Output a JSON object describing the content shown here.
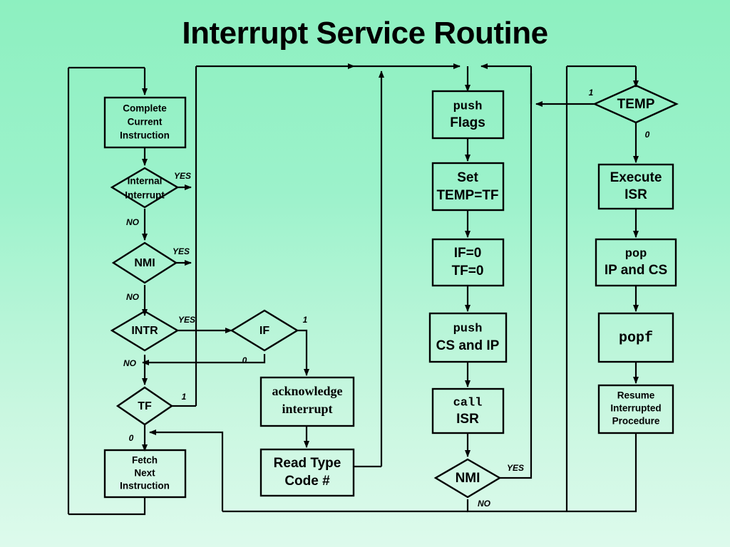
{
  "title": "Interrupt Service Routine",
  "colors": {
    "background_top": "#8df0c0",
    "background_bottom": "#ddfaec",
    "stroke": "#000000",
    "text": "#000000"
  },
  "nodes": {
    "complete_current_instruction": {
      "kind": "process",
      "lines": [
        "Complete",
        "Current",
        "Instruction"
      ]
    },
    "internal_interrupt": {
      "kind": "decision",
      "lines": [
        "Internal",
        "Interrupt"
      ]
    },
    "nmi_left": {
      "kind": "decision",
      "lines": [
        "NMI"
      ]
    },
    "intr": {
      "kind": "decision",
      "lines": [
        "INTR"
      ]
    },
    "if_flag": {
      "kind": "decision",
      "lines": [
        "IF"
      ]
    },
    "tf_flag": {
      "kind": "decision",
      "lines": [
        "TF"
      ]
    },
    "fetch_next_instruction": {
      "kind": "process",
      "lines": [
        "Fetch",
        "Next",
        "Instruction"
      ]
    },
    "acknowledge_interrupt": {
      "kind": "process",
      "lines": [
        "acknowledge",
        "interrupt"
      ]
    },
    "read_type_code": {
      "kind": "process",
      "lines": [
        "Read Type",
        "Code #"
      ]
    },
    "push_flags": {
      "kind": "process",
      "lines": [
        "push",
        "Flags"
      ]
    },
    "set_temp_tf": {
      "kind": "process",
      "lines": [
        "Set",
        "TEMP=TF"
      ]
    },
    "clear_if_tf": {
      "kind": "process",
      "lines": [
        "IF=0",
        "TF=0"
      ]
    },
    "push_cs_ip": {
      "kind": "process",
      "lines": [
        "push",
        "CS and IP"
      ]
    },
    "call_isr": {
      "kind": "process",
      "lines": [
        "call",
        "ISR"
      ]
    },
    "nmi_mid": {
      "kind": "decision",
      "lines": [
        "NMI"
      ]
    },
    "temp": {
      "kind": "decision",
      "lines": [
        "TEMP"
      ]
    },
    "execute_isr": {
      "kind": "process",
      "lines": [
        "Execute",
        "ISR"
      ]
    },
    "pop_ip_cs": {
      "kind": "process",
      "lines": [
        "pop",
        "IP and CS"
      ]
    },
    "popf": {
      "kind": "process",
      "lines": [
        "popf"
      ]
    },
    "resume_interrupted": {
      "kind": "process",
      "lines": [
        "Resume",
        "Interrupted",
        "Procedure"
      ]
    }
  },
  "edge_labels": {
    "internal_interrupt_yes": "YES",
    "internal_interrupt_no": "NO",
    "nmi_left_yes": "YES",
    "nmi_left_no": "NO",
    "intr_yes": "YES",
    "intr_no": "NO",
    "if_one": "1",
    "if_zero": "0",
    "tf_one": "1",
    "tf_zero": "0",
    "nmi_mid_yes": "YES",
    "nmi_mid_no": "NO",
    "temp_one": "1",
    "temp_zero": "0"
  },
  "chart_data": {
    "type": "flowchart",
    "title": "Interrupt Service Routine",
    "nodes": [
      {
        "id": "complete_current_instruction",
        "shape": "rect",
        "text": "Complete Current Instruction",
        "column": "left"
      },
      {
        "id": "internal_interrupt",
        "shape": "diamond",
        "text": "Internal Interrupt",
        "column": "left"
      },
      {
        "id": "nmi_left",
        "shape": "diamond",
        "text": "NMI",
        "column": "left"
      },
      {
        "id": "intr",
        "shape": "diamond",
        "text": "INTR",
        "column": "left"
      },
      {
        "id": "tf_flag",
        "shape": "diamond",
        "text": "TF",
        "column": "left"
      },
      {
        "id": "fetch_next_instruction",
        "shape": "rect",
        "text": "Fetch Next Instruction",
        "column": "left"
      },
      {
        "id": "if_flag",
        "shape": "diamond",
        "text": "IF",
        "column": "mid-left"
      },
      {
        "id": "acknowledge_interrupt",
        "shape": "rect",
        "text": "acknowledge interrupt",
        "column": "mid-left"
      },
      {
        "id": "read_type_code",
        "shape": "rect",
        "text": "Read Type Code #",
        "column": "mid-left"
      },
      {
        "id": "push_flags",
        "shape": "rect",
        "text": "push Flags",
        "column": "middle"
      },
      {
        "id": "set_temp_tf",
        "shape": "rect",
        "text": "Set TEMP=TF",
        "column": "middle"
      },
      {
        "id": "clear_if_tf",
        "shape": "rect",
        "text": "IF=0 TF=0",
        "column": "middle"
      },
      {
        "id": "push_cs_ip",
        "shape": "rect",
        "text": "push CS and IP",
        "column": "middle"
      },
      {
        "id": "call_isr",
        "shape": "rect",
        "text": "call ISR",
        "column": "middle"
      },
      {
        "id": "nmi_mid",
        "shape": "diamond",
        "text": "NMI",
        "column": "middle"
      },
      {
        "id": "temp",
        "shape": "diamond",
        "text": "TEMP",
        "column": "right"
      },
      {
        "id": "execute_isr",
        "shape": "rect",
        "text": "Execute ISR",
        "column": "right"
      },
      {
        "id": "pop_ip_cs",
        "shape": "rect",
        "text": "pop IP and CS",
        "column": "right"
      },
      {
        "id": "popf",
        "shape": "rect",
        "text": "popf",
        "column": "right"
      },
      {
        "id": "resume_interrupted",
        "shape": "rect",
        "text": "Resume Interrupted Procedure",
        "column": "right"
      }
    ],
    "edges": [
      {
        "from": "top-bus",
        "to": "complete_current_instruction",
        "label": ""
      },
      {
        "from": "complete_current_instruction",
        "to": "internal_interrupt",
        "label": ""
      },
      {
        "from": "internal_interrupt",
        "to": "riser-275",
        "label": "YES"
      },
      {
        "from": "internal_interrupt",
        "to": "nmi_left",
        "label": "NO"
      },
      {
        "from": "nmi_left",
        "to": "riser-275",
        "label": "YES"
      },
      {
        "from": "nmi_left",
        "to": "intr",
        "label": "NO"
      },
      {
        "from": "intr",
        "to": "if_flag",
        "label": "YES"
      },
      {
        "from": "intr",
        "to": "tf_flag",
        "label": "NO"
      },
      {
        "from": "if_flag",
        "to": "acknowledge_interrupt",
        "label": "1"
      },
      {
        "from": "if_flag",
        "to": "intr-no-path",
        "label": "0"
      },
      {
        "from": "tf_flag",
        "to": "riser-275",
        "label": "1"
      },
      {
        "from": "tf_flag",
        "to": "fetch_next_instruction",
        "label": "0"
      },
      {
        "from": "acknowledge_interrupt",
        "to": "read_type_code",
        "label": ""
      },
      {
        "from": "read_type_code",
        "to": "riser-535",
        "label": ""
      },
      {
        "from": "riser-535",
        "to": "top-bus",
        "label": ""
      },
      {
        "from": "top-bus",
        "to": "push_flags",
        "label": ""
      },
      {
        "from": "push_flags",
        "to": "set_temp_tf",
        "label": ""
      },
      {
        "from": "set_temp_tf",
        "to": "clear_if_tf",
        "label": ""
      },
      {
        "from": "clear_if_tf",
        "to": "push_cs_ip",
        "label": ""
      },
      {
        "from": "push_cs_ip",
        "to": "call_isr",
        "label": ""
      },
      {
        "from": "call_isr",
        "to": "nmi_mid",
        "label": ""
      },
      {
        "from": "nmi_mid",
        "to": "temp-entry-riser",
        "label": "YES"
      },
      {
        "from": "nmi_mid",
        "to": "bottom-return",
        "label": "NO"
      },
      {
        "from": "temp",
        "to": "push_flags-bus",
        "label": "1"
      },
      {
        "from": "temp",
        "to": "execute_isr",
        "label": "0"
      },
      {
        "from": "execute_isr",
        "to": "pop_ip_cs",
        "label": ""
      },
      {
        "from": "pop_ip_cs",
        "to": "popf",
        "label": ""
      },
      {
        "from": "popf",
        "to": "resume_interrupted",
        "label": ""
      },
      {
        "from": "resume_interrupted",
        "to": "bottom-bus",
        "label": ""
      },
      {
        "from": "fetch_next_instruction",
        "to": "left-return-bus",
        "label": ""
      },
      {
        "from": "left-return-bus",
        "to": "complete_current_instruction",
        "label": ""
      }
    ]
  }
}
